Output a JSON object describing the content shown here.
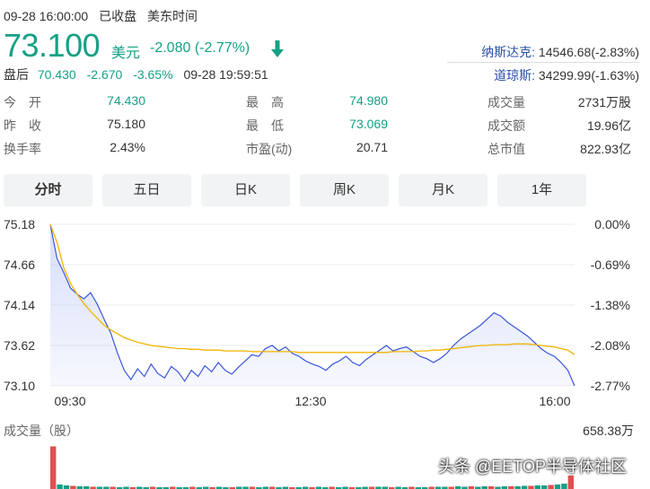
{
  "header": {
    "datetime": "09-28 16:00:00",
    "status": "已收盘",
    "timezone": "美东时间"
  },
  "quote": {
    "price": "73.100",
    "currency": "美元",
    "change": "-2.080 (-2.77%)",
    "direction_icon": "down-arrow-icon",
    "color": "#16a085"
  },
  "after_hours": {
    "label": "盘后",
    "price": "70.430",
    "change": "-2.670",
    "percent": "-3.65%",
    "time": "09-28 19:59:51"
  },
  "indices": [
    {
      "name": "纳斯达克:",
      "value": "14546.68(-2.83%)"
    },
    {
      "name": "道琼斯:",
      "value": "34299.99(-1.63%)"
    }
  ],
  "stats": [
    {
      "key": "今　开",
      "value": "74.430",
      "tone": "g"
    },
    {
      "key": "最　高",
      "value": "74.980",
      "tone": "g"
    },
    {
      "key": "成交量",
      "value": "2731万股",
      "tone": "d"
    },
    {
      "key": "昨　收",
      "value": "75.180",
      "tone": "d"
    },
    {
      "key": "最　低",
      "value": "73.069",
      "tone": "g"
    },
    {
      "key": "成交额",
      "value": "19.96亿",
      "tone": "d"
    },
    {
      "key": "换手率",
      "value": "2.43%",
      "tone": "d"
    },
    {
      "key": "市盈(动)",
      "value": "20.71",
      "tone": "d"
    },
    {
      "key": "总市值",
      "value": "822.93亿",
      "tone": "d"
    }
  ],
  "tabs": [
    {
      "label": "分时",
      "active": true
    },
    {
      "label": "五日",
      "active": false
    },
    {
      "label": "日K",
      "active": false
    },
    {
      "label": "周K",
      "active": false
    },
    {
      "label": "月K",
      "active": false
    },
    {
      "label": "1年",
      "active": false
    }
  ],
  "chart_data": {
    "type": "line",
    "y_ticks_price": [
      "75.18",
      "74.66",
      "74.14",
      "73.62",
      "73.10"
    ],
    "y_ticks_pct": [
      "0.00%",
      "-0.69%",
      "-1.38%",
      "-2.08%",
      "-2.77%"
    ],
    "ylim": [
      73.1,
      75.18
    ],
    "x_ticks": [
      "09:30",
      "12:30",
      "16:00"
    ],
    "series": [
      {
        "color": "#3b57d8",
        "values": [
          75.18,
          74.74,
          74.56,
          74.36,
          74.28,
          74.22,
          74.3,
          74.15,
          73.96,
          73.78,
          73.52,
          73.3,
          73.18,
          73.32,
          73.22,
          73.38,
          73.26,
          73.2,
          73.35,
          73.28,
          73.16,
          73.3,
          73.22,
          73.36,
          73.28,
          73.4,
          73.3,
          73.25,
          73.34,
          73.42,
          73.5,
          73.48,
          73.58,
          73.62,
          73.55,
          73.6,
          73.52,
          73.48,
          73.42,
          73.38,
          73.35,
          73.3,
          73.38,
          73.42,
          73.48,
          73.4,
          73.36,
          73.44,
          73.5,
          73.56,
          73.62,
          73.55,
          73.58,
          73.6,
          73.54,
          73.48,
          73.45,
          73.4,
          73.45,
          73.52,
          73.62,
          73.7,
          73.76,
          73.82,
          73.88,
          73.96,
          74.04,
          74.0,
          73.92,
          73.86,
          73.8,
          73.74,
          73.66,
          73.58,
          73.52,
          73.48,
          73.4,
          73.3,
          73.1
        ]
      },
      {
        "color": "#f0b400",
        "values": [
          75.18,
          74.95,
          74.62,
          74.42,
          74.28,
          74.16,
          74.06,
          73.97,
          73.88,
          73.82,
          73.77,
          73.72,
          73.69,
          73.66,
          73.64,
          73.62,
          73.61,
          73.6,
          73.59,
          73.58,
          73.58,
          73.57,
          73.57,
          73.56,
          73.56,
          73.56,
          73.55,
          73.55,
          73.55,
          73.55,
          73.54,
          73.54,
          73.54,
          73.54,
          73.54,
          73.54,
          73.54,
          73.53,
          73.53,
          73.53,
          73.53,
          73.53,
          73.53,
          73.53,
          73.53,
          73.53,
          73.53,
          73.53,
          73.53,
          73.53,
          73.53,
          73.54,
          73.54,
          73.54,
          73.54,
          73.55,
          73.55,
          73.56,
          73.56,
          73.57,
          73.58,
          73.59,
          73.6,
          73.61,
          73.62,
          73.62,
          73.63,
          73.63,
          73.63,
          73.64,
          73.64,
          73.64,
          73.63,
          73.62,
          73.61,
          73.6,
          73.58,
          73.56,
          73.5
        ]
      }
    ]
  },
  "volume": {
    "label": "成交量（股）",
    "max": "658.38万",
    "values": [
      0.95,
      0.1,
      0.08,
      0.07,
      0.06,
      0.06,
      0.05,
      0.05,
      0.05,
      0.05,
      0.04,
      0.05,
      0.04,
      0.05,
      0.04,
      0.05,
      0.04,
      0.04,
      0.05,
      0.04,
      0.04,
      0.05,
      0.04,
      0.05,
      0.04,
      0.05,
      0.04,
      0.04,
      0.05,
      0.05,
      0.05,
      0.04,
      0.05,
      0.05,
      0.04,
      0.05,
      0.04,
      0.04,
      0.05,
      0.04,
      0.05,
      0.04,
      0.05,
      0.04,
      0.05,
      0.04,
      0.04,
      0.05,
      0.05,
      0.05,
      0.05,
      0.04,
      0.05,
      0.04,
      0.05,
      0.04,
      0.04,
      0.05,
      0.05,
      0.05,
      0.05,
      0.06,
      0.05,
      0.06,
      0.05,
      0.06,
      0.06,
      0.05,
      0.06,
      0.06,
      0.06,
      0.07,
      0.07,
      0.08,
      0.08,
      0.09,
      0.1,
      0.12,
      0.3
    ]
  },
  "watermark": "头条 @EETOP半导体社区"
}
